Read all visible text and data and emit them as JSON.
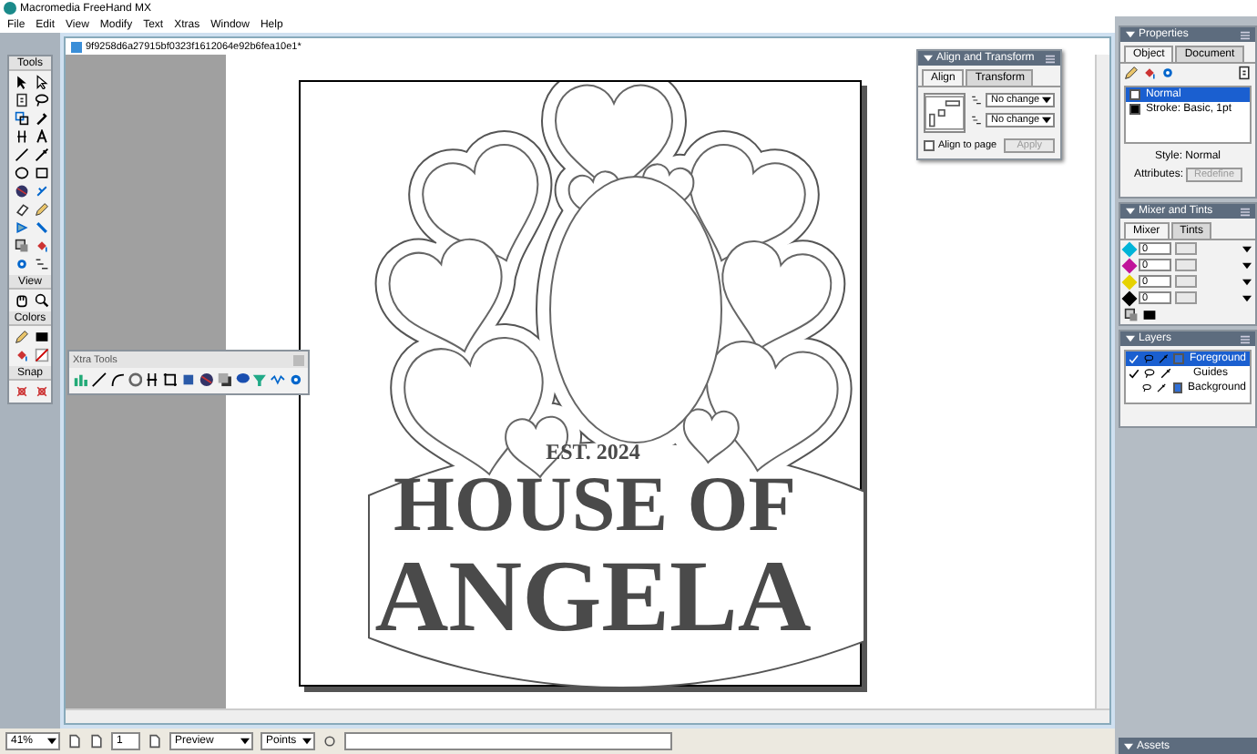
{
  "window": {
    "title": "Macromedia FreeHand MX"
  },
  "menu": [
    "File",
    "Edit",
    "View",
    "Modify",
    "Text",
    "Xtras",
    "Window",
    "Help"
  ],
  "tools_panel": {
    "title": "Tools",
    "sections": [
      "View",
      "Colors",
      "Snap"
    ]
  },
  "document": {
    "title": "9f9258d6a27915bf0323f1612064e92b6fea10e1*",
    "artwork_texts": [
      "EST. 2024",
      "HOUSE OF",
      "ANGELA"
    ]
  },
  "xtra_tools": {
    "title": "Xtra Tools"
  },
  "align_panel": {
    "title": "Align and Transform",
    "tabs": [
      {
        "label": "Align",
        "selected": true
      },
      {
        "label": "Transform",
        "selected": false
      }
    ],
    "dropdowns": [
      "No change",
      "No change"
    ],
    "align_to_page": {
      "label": "Align to page",
      "checked": false
    },
    "apply": {
      "label": "Apply",
      "disabled": true
    }
  },
  "properties": {
    "title": "Properties",
    "tabs": [
      {
        "label": "Object",
        "selected": true
      },
      {
        "label": "Document",
        "selected": false
      }
    ],
    "items": [
      {
        "label": "Normal",
        "selected": true,
        "color": "#ffffff"
      },
      {
        "label": "Stroke: Basic, 1pt",
        "selected": false,
        "color": "#000000"
      }
    ],
    "style_label": "Style: Normal",
    "attributes_label": "Attributes:",
    "redefine": {
      "label": "Redefine",
      "disabled": true
    }
  },
  "mixer": {
    "title": "Mixer and Tints",
    "tabs": [
      {
        "label": "Mixer",
        "selected": true
      },
      {
        "label": "Tints",
        "selected": false
      }
    ],
    "channels": [
      {
        "value": "0",
        "color": "#00b4d8"
      },
      {
        "value": "0",
        "color": "#c0149a"
      },
      {
        "value": "0",
        "color": "#e6d200"
      },
      {
        "value": "0",
        "color": "#000000"
      }
    ]
  },
  "layers": {
    "title": "Layers",
    "items": [
      {
        "label": "Foreground",
        "selected": true,
        "printable": true,
        "color": "#2f6fd8"
      },
      {
        "label": "Guides",
        "selected": false,
        "printable": true
      },
      {
        "label": "Background",
        "selected": false,
        "printable": false,
        "color": "#2f6fd8"
      }
    ]
  },
  "assets": {
    "title": "Assets"
  },
  "status_bar": {
    "zoom": "41%",
    "page": "1",
    "view_mode": "Preview",
    "units": "Points"
  }
}
